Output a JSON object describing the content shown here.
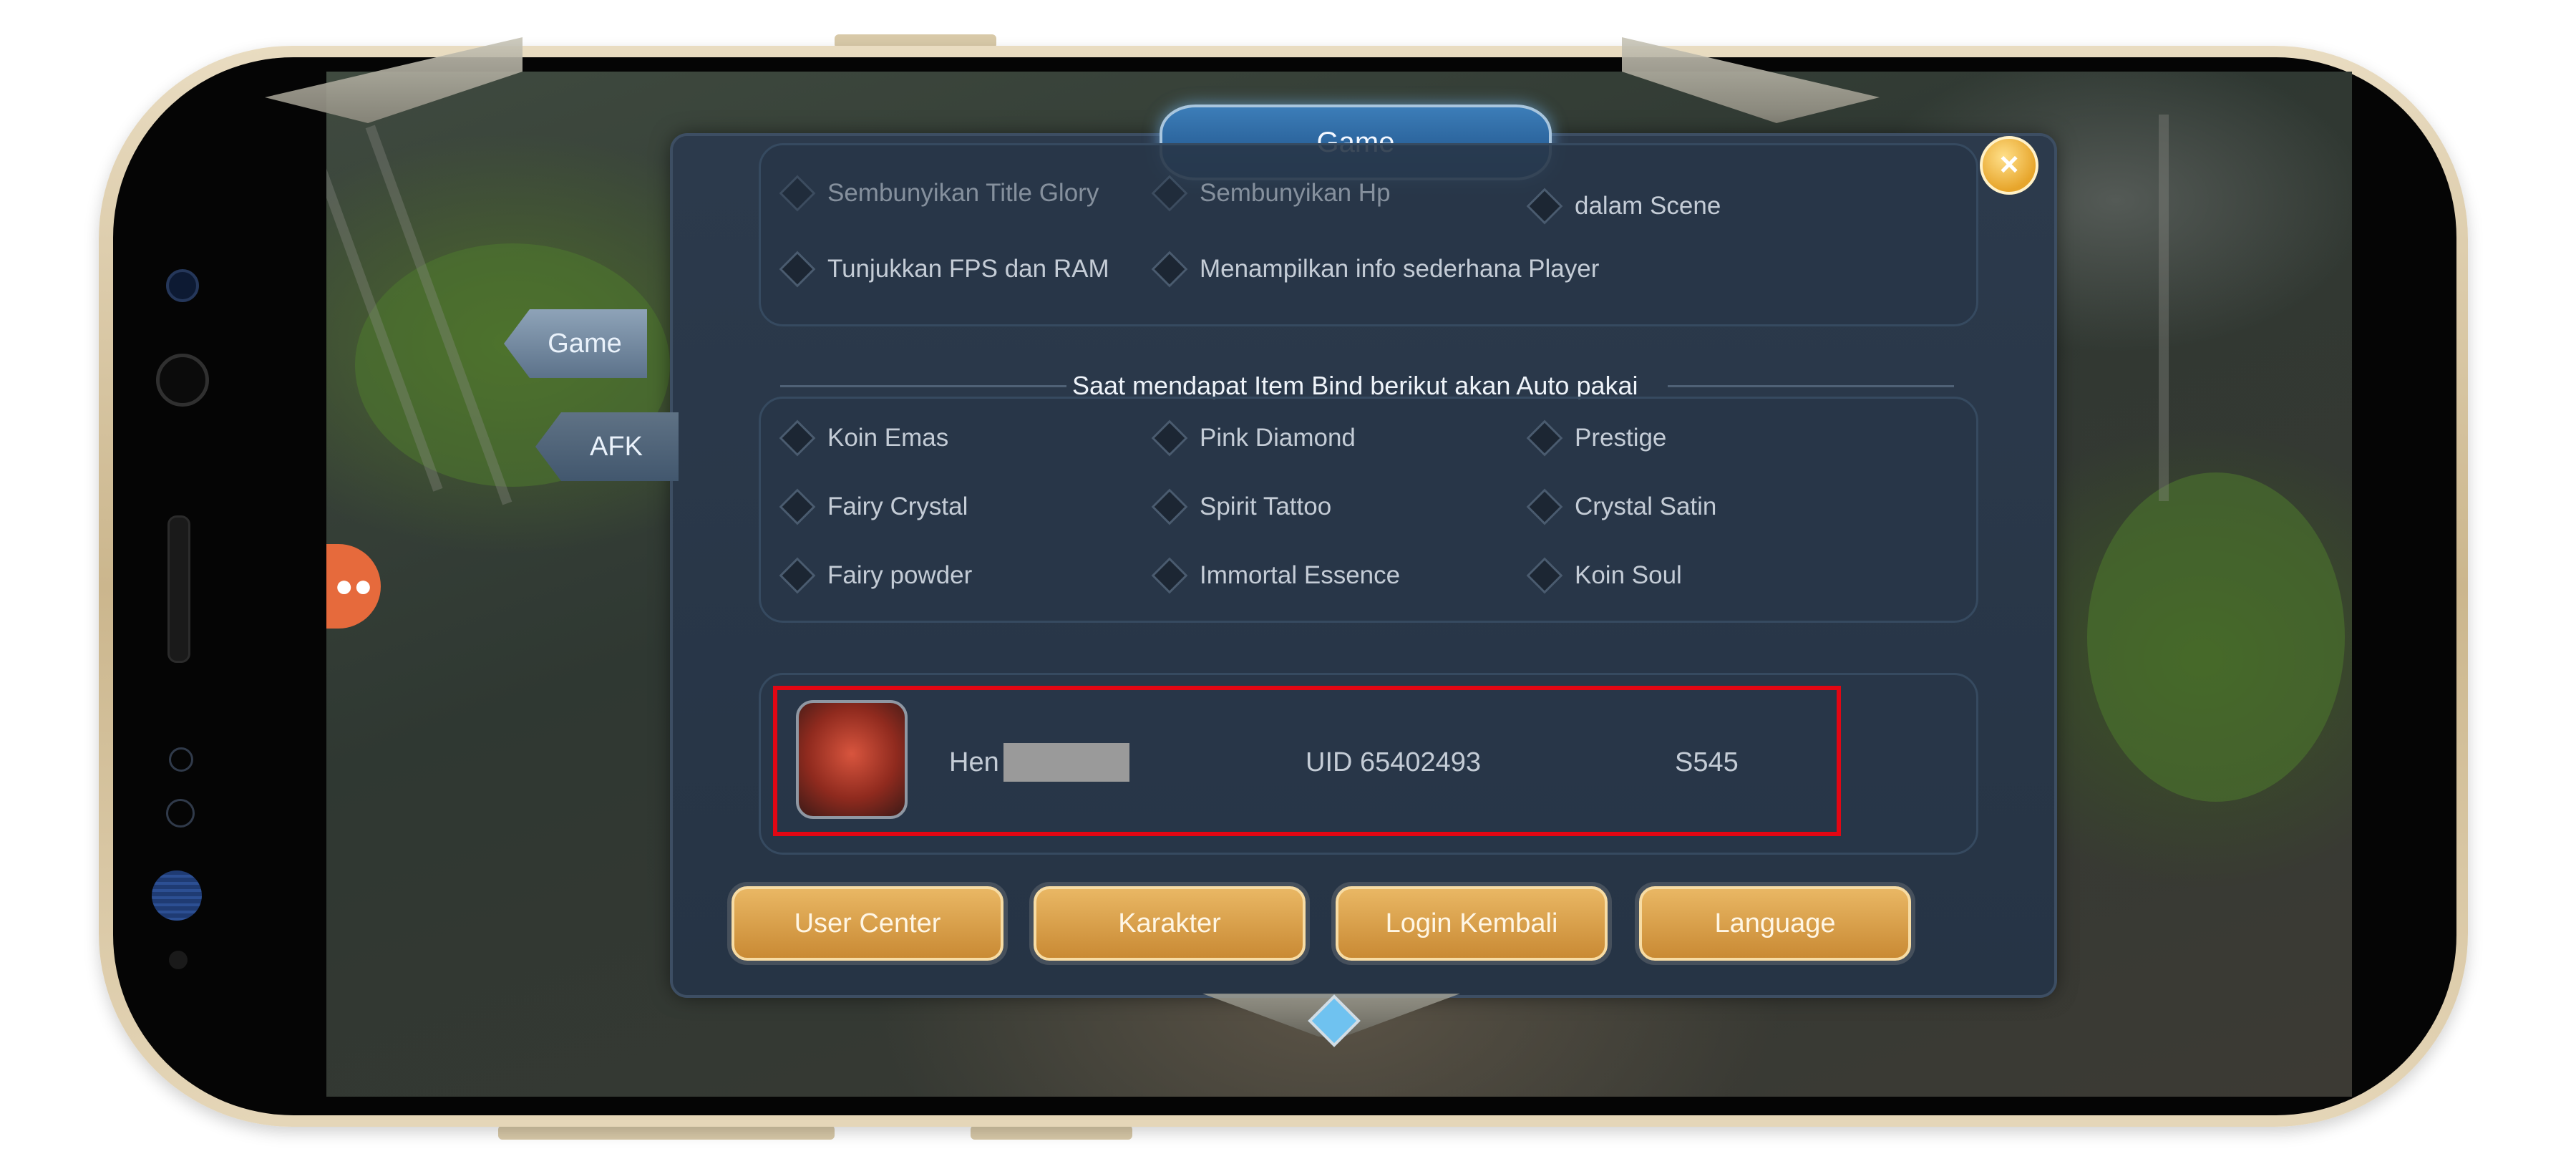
{
  "window": {
    "title": "Game",
    "close_icon": "close-icon"
  },
  "side_tabs": [
    {
      "label": "Game",
      "active": true
    },
    {
      "label": "AFK",
      "active": false
    }
  ],
  "top_options": {
    "row0": [
      "Sembunyikan Title Glory",
      "Sembunyikan Hp",
      "dalam Scene"
    ],
    "row1": [
      "Tunjukkan FPS dan RAM",
      "Menampilkan info sederhana Player"
    ]
  },
  "auto_use": {
    "title": "Saat mendapat Item Bind berikut akan Auto pakai",
    "items": [
      "Koin Emas",
      "Pink Diamond",
      "Prestige",
      "Fairy Crystal",
      "Spirit Tattoo",
      "Crystal Satin",
      "Fairy powder",
      "Immortal Essence",
      "Koin Soul"
    ]
  },
  "player": {
    "name_prefix": "Hen",
    "uid": "UID 65402493",
    "server": "S545"
  },
  "buttons": [
    "User Center",
    "Karakter",
    "Login Kembali",
    "Language"
  ],
  "colors": {
    "highlight": "#e30613",
    "button": "#d69a44",
    "panel": "#2a384a"
  }
}
